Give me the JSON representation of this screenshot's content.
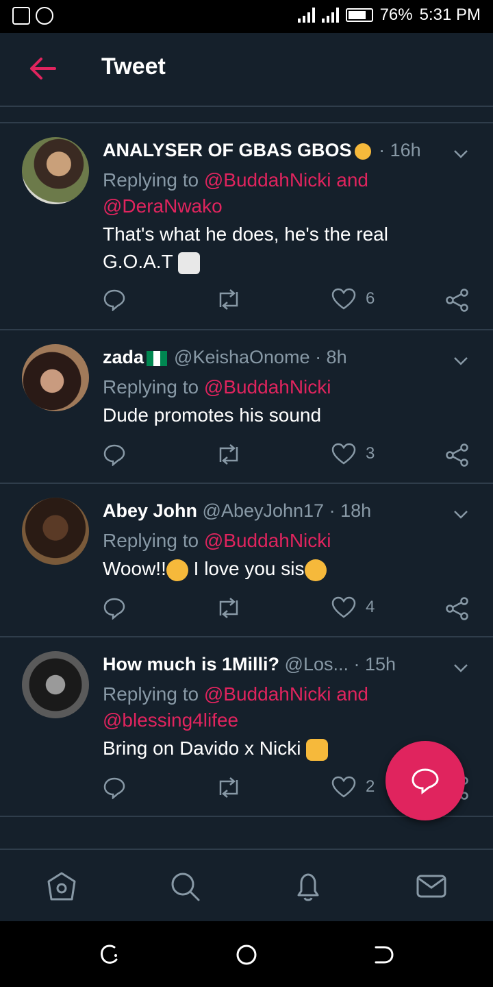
{
  "status_bar": {
    "battery": "76%",
    "time": "5:31 PM"
  },
  "header": {
    "title": "Tweet"
  },
  "tweets": [
    {
      "name": "ANALYSER OF GBAS GBOS",
      "handle": "",
      "time": "· 16h",
      "reply_prefix": "Replying to ",
      "reply_to": "@BuddahNicki and @DeraNwako",
      "text": "That's what he does, he's the real G.O.A.T",
      "likes": "6"
    },
    {
      "name": "zada",
      "handle": "@KeishaOnome",
      "time": "· 8h",
      "reply_prefix": "Replying to ",
      "reply_to": "@BuddahNicki",
      "text": "Dude promotes his sound",
      "likes": "3"
    },
    {
      "name": "Abey John",
      "handle": "@AbeyJohn17",
      "time": "· 18h",
      "reply_prefix": "Replying to ",
      "reply_to": "@BuddahNicki",
      "text": "Woow!!",
      "text_b": "I love you sis",
      "likes": "4"
    },
    {
      "name": "How much is 1Milli?",
      "handle": "@Los...",
      "time": "· 15h",
      "reply_prefix": "Replying to ",
      "reply_to": "@BuddahNicki and @blessing4lifee",
      "text": "Bring on Davido x Nicki",
      "likes": "2"
    }
  ],
  "colors": {
    "background": "#15202b",
    "accent": "#e0245e",
    "muted": "#8899a6",
    "divider": "#2f3d4b"
  },
  "icons": {
    "tab_bar": [
      "home-icon",
      "search-icon",
      "notifications-icon",
      "messages-icon"
    ],
    "actions": [
      "reply-icon",
      "retweet-icon",
      "like-icon",
      "share-icon"
    ]
  }
}
